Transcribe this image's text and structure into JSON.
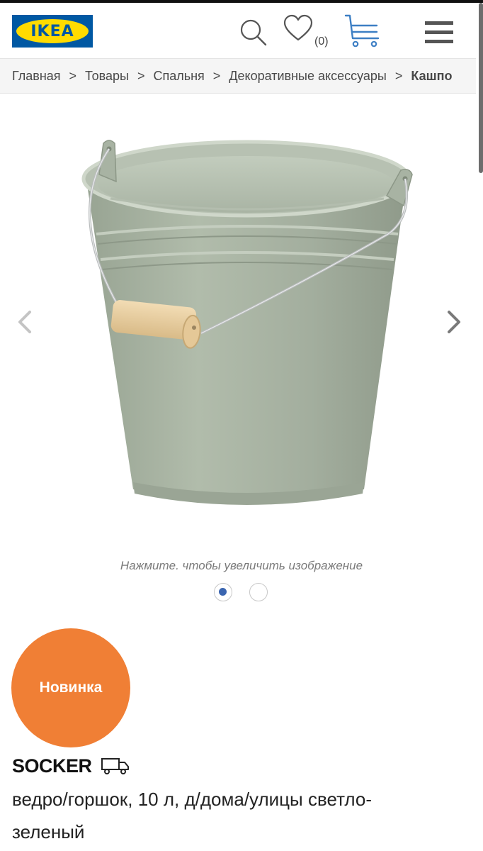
{
  "header": {
    "logo_text": "IKEA",
    "wishlist_count": "(0)",
    "icons": [
      "search-icon",
      "heart-icon",
      "cart-icon",
      "menu-icon"
    ],
    "brand_colors": {
      "blue": "#0058a3",
      "yellow": "#ffdb00"
    }
  },
  "breadcrumb": {
    "items": [
      "Главная",
      "Товары",
      "Спальня",
      "Декоративные аксессуары"
    ],
    "separator": ">",
    "current": "Кашпо"
  },
  "gallery": {
    "zoom_hint": "Нажмите. чтобы увеличить изображение",
    "image_count": 2,
    "active_index": 1,
    "product_color": "#a6b2a0"
  },
  "product": {
    "badge": "Новинка",
    "badge_color": "#f07f35",
    "name": "SOCKER",
    "description": "ведро/горшок, 10 л, д/дома/улицы светло-зеленый"
  }
}
